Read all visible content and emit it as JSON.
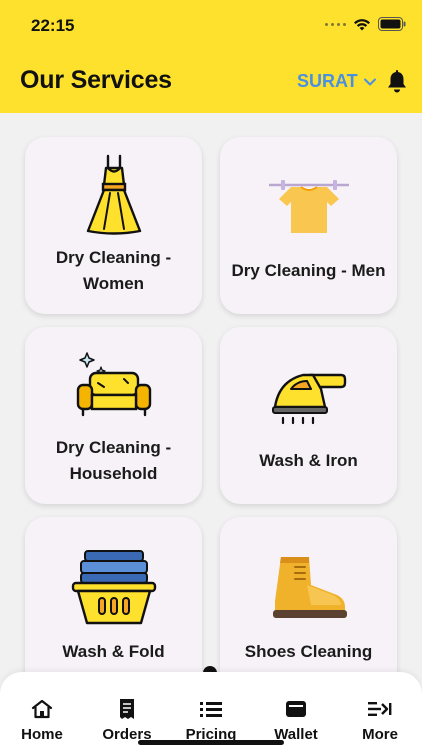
{
  "status_bar": {
    "time": "22:15",
    "icons": [
      "signal-dots",
      "wifi-icon",
      "battery-icon"
    ]
  },
  "header": {
    "title": "Our Services",
    "city": "SURAT",
    "colors": {
      "background": "#fde12d",
      "city": "#4a90e2"
    }
  },
  "services": [
    {
      "label": "Dry Cleaning - Women",
      "line1": "Dry Cleaning -",
      "line2": "Women",
      "icon": "dress-icon"
    },
    {
      "label": "Dry Cleaning - Men",
      "line1": "Dry Cleaning - Men",
      "line2": "",
      "icon": "shirt-hanger-icon"
    },
    {
      "label": "Dry Cleaning - Household",
      "line1": "Dry Cleaning -",
      "line2": "Household",
      "icon": "sofa-icon"
    },
    {
      "label": "Wash & Iron",
      "line1": "Wash & Iron",
      "line2": "",
      "icon": "iron-icon"
    },
    {
      "label": "Wash & Fold",
      "line1": "Wash & Fold",
      "line2": "",
      "icon": "laundry-basket-icon"
    },
    {
      "label": "Shoes Cleaning",
      "line1": "Shoes Cleaning",
      "line2": "",
      "icon": "boot-icon"
    }
  ],
  "tabbar": [
    {
      "label": "Home",
      "icon": "home-icon"
    },
    {
      "label": "Orders",
      "icon": "receipt-icon"
    },
    {
      "label": "Pricing",
      "icon": "list-icon"
    },
    {
      "label": "Wallet",
      "icon": "wallet-icon"
    },
    {
      "label": "More",
      "icon": "more-arrow-icon"
    }
  ]
}
